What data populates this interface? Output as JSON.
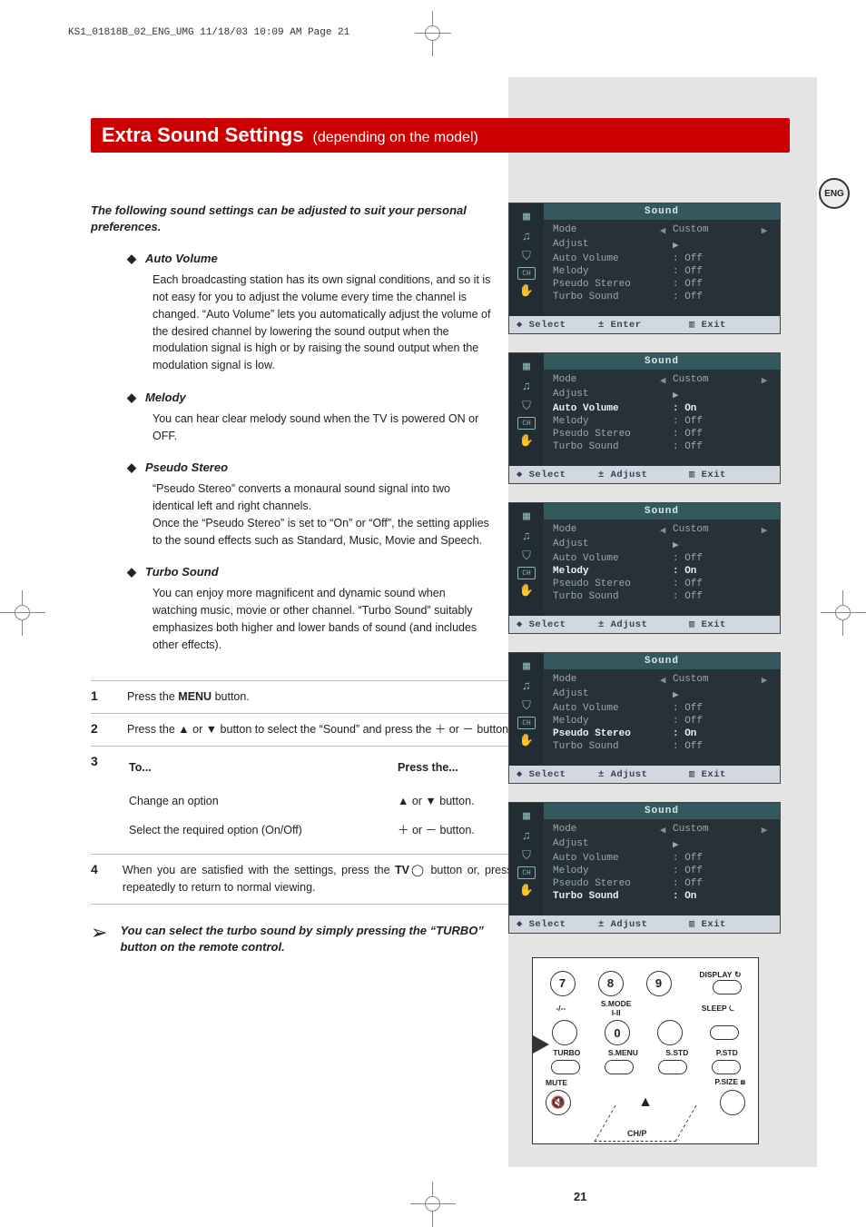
{
  "header_tag": "KS1_01818B_02_ENG_UMG  11/18/03  10:09 AM  Page 21",
  "lang_badge": "ENG",
  "title": {
    "main": "Extra Sound Settings",
    "sub": "(depending on the model)"
  },
  "intro": "The following sound settings can be adjusted to suit your personal preferences.",
  "sections": [
    {
      "head": "Auto Volume",
      "body": "Each broadcasting station has its own signal conditions, and so it is not easy for you to adjust the volume every time the channel is changed. “Auto Volume” lets you automatically adjust the volume of the desired channel by lowering the sound output when the modulation signal is high or by raising the sound output when the modulation signal is low."
    },
    {
      "head": "Melody",
      "body": "You can hear clear melody sound when the TV is powered ON or OFF."
    },
    {
      "head": "Pseudo Stereo",
      "body": "“Pseudo Stereo” converts a monaural sound signal into two identical left and right channels.\nOnce the “Pseudo Stereo” is set to “On” or “Off”, the setting applies to the sound effects such as Standard, Music, Movie and Speech."
    },
    {
      "head": "Turbo Sound",
      "body": "You can enjoy more magnificent and dynamic sound when watching music, movie or other channel. “Turbo Sound” suitably emphasizes both higher and lower bands of sound (and includes other effects)."
    }
  ],
  "steps": {
    "s1": "Press the MENU button.",
    "s2": "Press the ▲ or ▼ button to select the “Sound” and press the ＋ or － button.",
    "s3": {
      "head_to": "To...",
      "head_press": "Press the...",
      "rows": [
        {
          "to": "Change an option",
          "press": "▲ or ▼ button."
        },
        {
          "to": "Select the required option (On/Off)",
          "press": "＋ or － button."
        }
      ]
    },
    "s4": "When you are satisfied with the settings, press the TV◯ button or, press the MENU button repeatedly to return to normal viewing."
  },
  "note": "You can select the turbo sound by simply pressing the “TURBO” button on the remote control.",
  "osd": {
    "title": "Sound",
    "rows": [
      {
        "label": "Mode",
        "arrows": true,
        "value": "Custom"
      },
      {
        "label": "Adjust",
        "arrows": false,
        "value": "▶"
      },
      {
        "label": "Auto Volume",
        "arrows": false,
        "value": ": Off"
      },
      {
        "label": "Melody",
        "arrows": false,
        "value": ": Off"
      },
      {
        "label": "Pseudo Stereo",
        "arrows": false,
        "value": ": Off"
      },
      {
        "label": "Turbo Sound",
        "arrows": false,
        "value": ": Off"
      }
    ],
    "foot_select": "Select",
    "foot_enter": "Enter",
    "foot_adjust": "Adjust",
    "foot_exit": "Exit",
    "variants": [
      {
        "highlight": null,
        "on_row": null,
        "foot_mid": "enter"
      },
      {
        "highlight": "Auto Volume",
        "on_row": "Auto Volume",
        "foot_mid": "adjust"
      },
      {
        "highlight": "Melody",
        "on_row": "Melody",
        "foot_mid": "adjust"
      },
      {
        "highlight": "Pseudo Stereo",
        "on_row": "Pseudo Stereo",
        "foot_mid": "adjust"
      },
      {
        "highlight": "Turbo Sound",
        "on_row": "Turbo Sound",
        "foot_mid": "adjust"
      }
    ]
  },
  "remote": {
    "labels": {
      "display": "DISPLAY",
      "smode": "S.MODE",
      "sleep": "SLEEP",
      "turbo": "TURBO",
      "smenu": "S.MENU",
      "sstd": "S.STD",
      "pstd": "P.STD",
      "mute": "MUTE",
      "psize": "P.SIZE",
      "chp": "CH/P",
      "dash": "-/--",
      "pip": "I-II"
    },
    "digits": {
      "d7": "7",
      "d8": "8",
      "d9": "9",
      "d0": "0"
    }
  },
  "page_number": "21"
}
